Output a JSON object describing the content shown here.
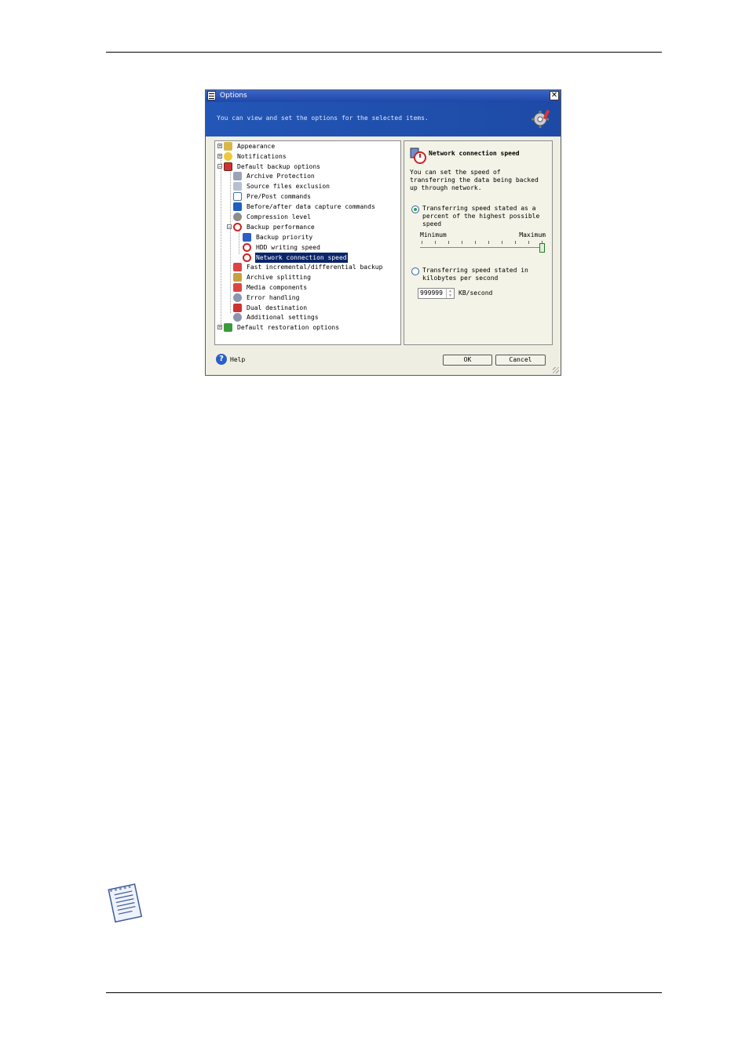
{
  "window": {
    "title": "Options"
  },
  "banner": {
    "text": "You can view and set the options for the selected items."
  },
  "tree": {
    "items": [
      {
        "label": "Appearance"
      },
      {
        "label": "Notifications"
      },
      {
        "label": "Default backup options"
      },
      {
        "label": "Archive Protection"
      },
      {
        "label": "Source files exclusion"
      },
      {
        "label": "Pre/Post commands"
      },
      {
        "label": "Before/after data capture commands"
      },
      {
        "label": "Compression level"
      },
      {
        "label": "Backup performance"
      },
      {
        "label": "Backup priority"
      },
      {
        "label": "HDD writing speed"
      },
      {
        "label": "Network connection speed"
      },
      {
        "label": "Fast incremental/differential backup"
      },
      {
        "label": "Archive splitting"
      },
      {
        "label": "Media components"
      },
      {
        "label": "Error handling"
      },
      {
        "label": "Dual destination"
      },
      {
        "label": "Additional settings"
      },
      {
        "label": "Default restoration options"
      }
    ],
    "selected": "Network connection speed"
  },
  "panel": {
    "heading": "Network connection speed",
    "description": "You can set the speed of transferring the data being backed up through network.",
    "option_percent": "Transferring speed stated as a percent of the highest possible speed",
    "slider": {
      "min_label": "Minimum",
      "max_label": "Maximum",
      "level_fraction": 1.0
    },
    "option_kbps": "Transferring speed stated in kilobytes per second",
    "kbps_value": "999999",
    "kbps_unit": "KB/second",
    "selected_option": "percent"
  },
  "footer": {
    "help_label": "Help",
    "ok_label": "OK",
    "cancel_label": "Cancel"
  },
  "colors": {
    "banner": "#2356b6",
    "selection": "#0a246a",
    "dialog_bg": "#efeee3"
  }
}
